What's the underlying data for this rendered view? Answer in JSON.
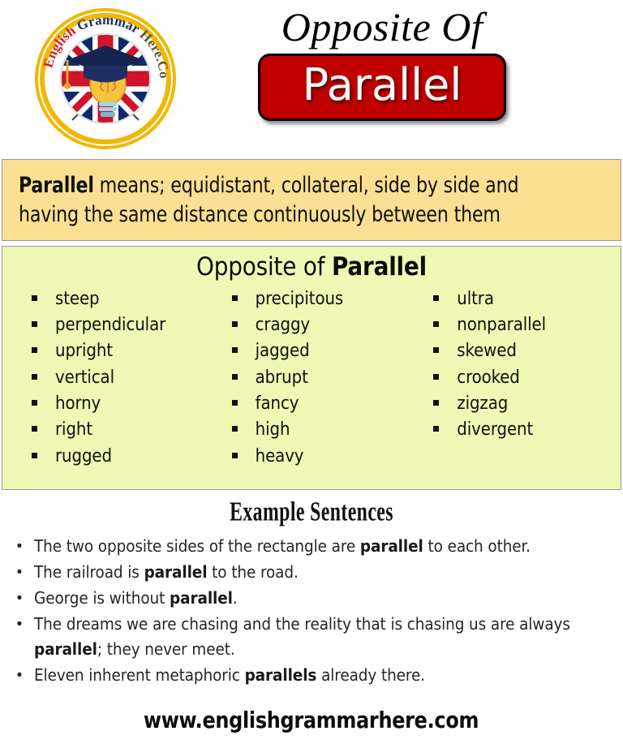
{
  "logo": {
    "text_english": "English",
    "text_grammar": "Grammar",
    "text_here": "Here.Com",
    "ring_color": "#F2B705",
    "english_color": "#D61E1E",
    "grammar_color": "#1F2E6B",
    "here_color": "#5A5A28"
  },
  "header": {
    "title_prefix": "Opposite Of",
    "word": "Parallel",
    "badge_bg": "#C00000",
    "badge_text_color": "#FFFFFF"
  },
  "definition": {
    "term": "Parallel",
    "body": " means; equidistant, collateral, side by side and having the same distance continuously between them",
    "bg_color": "#FBDF92"
  },
  "opposites": {
    "heading_prefix": "Opposite of ",
    "heading_word": "Parallel",
    "bg_color": "#EFF8B4",
    "columns": [
      [
        "steep",
        "perpendicular",
        "upright",
        "vertical",
        "horny",
        "right",
        "rugged"
      ],
      [
        "precipitous",
        "craggy",
        "jagged",
        "abrupt",
        "fancy",
        "high",
        "heavy"
      ],
      [
        "ultra",
        "nonparallel",
        "skewed",
        "crooked",
        "zigzag",
        "divergent"
      ]
    ]
  },
  "examples": {
    "heading": "Example  Sentences",
    "sentences": [
      [
        {
          "t": "The two opposite sides of the rectangle are ",
          "b": false
        },
        {
          "t": "parallel",
          "b": true
        },
        {
          "t": " to each other.",
          "b": false
        }
      ],
      [
        {
          "t": "The railroad is ",
          "b": false
        },
        {
          "t": "parallel",
          "b": true
        },
        {
          "t": " to the road.",
          "b": false
        }
      ],
      [
        {
          "t": "George is without ",
          "b": false
        },
        {
          "t": "parallel",
          "b": true
        },
        {
          "t": ".",
          "b": false
        }
      ],
      [
        {
          "t": "The dreams we are chasing and the reality that is chasing us are always ",
          "b": false
        },
        {
          "t": "parallel",
          "b": true
        },
        {
          "t": "; they never meet.",
          "b": false
        }
      ],
      [
        {
          "t": "Eleven inherent metaphoric ",
          "b": false
        },
        {
          "t": "parallels",
          "b": true
        },
        {
          "t": " already there.",
          "b": false
        }
      ]
    ]
  },
  "footer": {
    "url": "www.englishgrammarhere.com"
  }
}
